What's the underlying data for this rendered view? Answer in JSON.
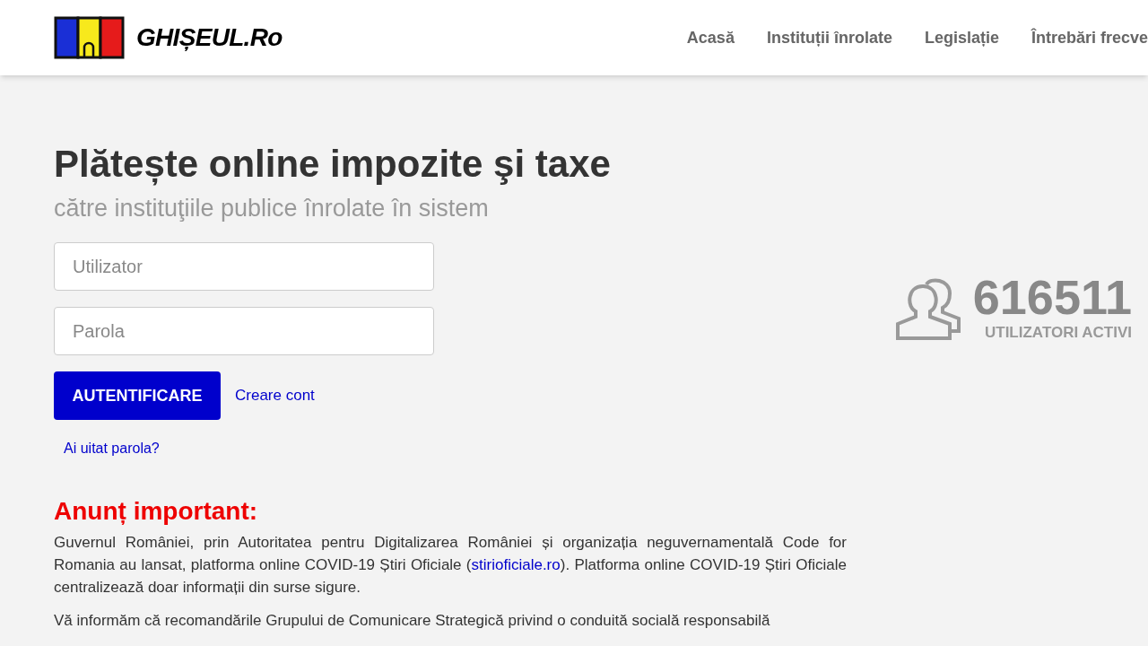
{
  "header": {
    "logo_text": "GHIȘEUL.Ro",
    "nav": [
      {
        "label": "Acasă"
      },
      {
        "label": "Instituții înrolate"
      },
      {
        "label": "Legislație"
      },
      {
        "label": "Întrebări frecve"
      }
    ]
  },
  "hero": {
    "title": "Plătește online impozite şi taxe",
    "subtitle": "către instituţiile publice înrolate în sistem"
  },
  "login": {
    "username": {
      "placeholder": "Utilizator"
    },
    "password": {
      "placeholder": "Parola"
    },
    "submit": "AUTENTIFICARE",
    "register": "Creare cont",
    "forgot": "Ai uitat parola?"
  },
  "stats": {
    "count": "616511",
    "label": "UTILIZATORI ACTIVI"
  },
  "announcement": {
    "title": "Anunț important:",
    "paragraphs": [
      {
        "before": "Guvernul României, prin Autoritatea pentru Digitalizarea României și organizația neguvernamentală Code for Romania au lansat, platforma online COVID-19 Știri Oficiale (",
        "link": "stirioficiale.ro",
        "after": "). Platforma online COVID-19 Știri Oficiale centralizează doar informații din surse sigure."
      },
      {
        "before": "Vă informăm că recomandările Grupului de Comunicare Strategică privind o conduită socială responsabilă"
      }
    ]
  }
}
